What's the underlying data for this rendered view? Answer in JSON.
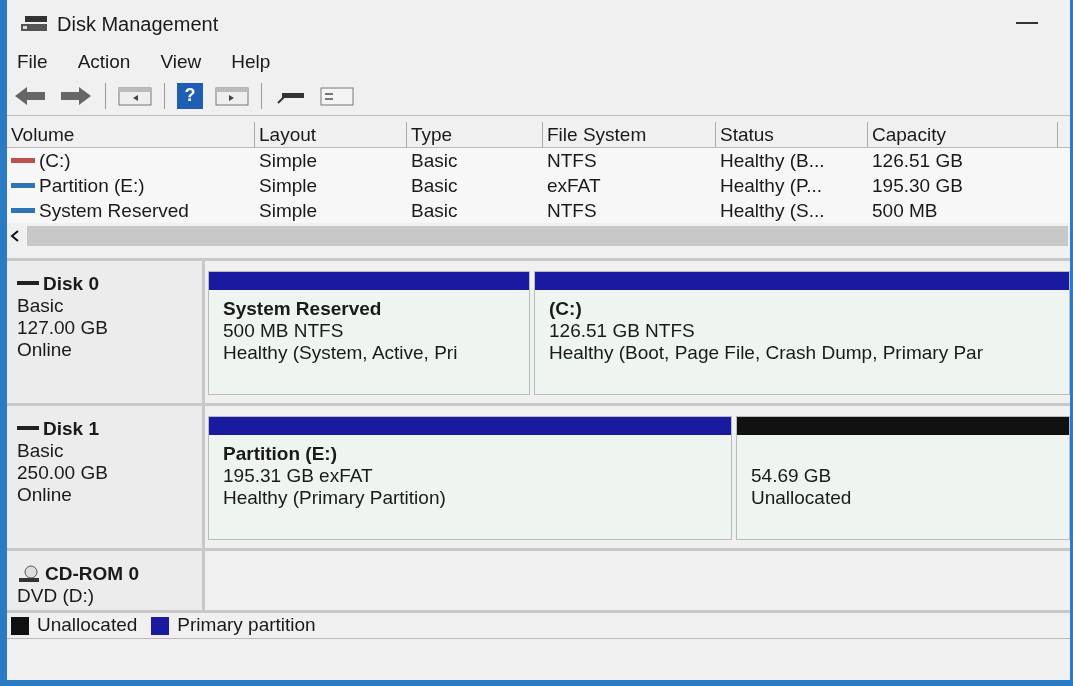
{
  "window": {
    "title": "Disk Management"
  },
  "menu": [
    "File",
    "Action",
    "View",
    "Help"
  ],
  "toolbar": {
    "help_glyph": "?"
  },
  "table": {
    "columns": [
      "Volume",
      "Layout",
      "Type",
      "File System",
      "Status",
      "Capacity"
    ],
    "rows": [
      {
        "cells": [
          "(C:)",
          "Simple",
          "Basic",
          "NTFS",
          "Healthy (B...",
          "126.51 GB"
        ]
      },
      {
        "cells": [
          "Partition (E:)",
          "Simple",
          "Basic",
          "exFAT",
          "Healthy (P...",
          "195.30 GB"
        ]
      },
      {
        "cells": [
          "System Reserved",
          "Simple",
          "Basic",
          "NTFS",
          "Healthy (S...",
          "500 MB"
        ]
      }
    ]
  },
  "disks": [
    {
      "kind": "disk",
      "name": "Disk 0",
      "lines": [
        "Basic",
        "127.00 GB",
        "Online"
      ],
      "partitions": [
        {
          "kind": "primary",
          "name": "System Reserved",
          "size": "500 MB NTFS",
          "status": "Healthy (System, Active, Pri"
        },
        {
          "kind": "primary",
          "name": "(C:)",
          "size": "126.51 GB NTFS",
          "status": "Healthy (Boot, Page File, Crash Dump, Primary Par"
        }
      ]
    },
    {
      "kind": "disk",
      "name": "Disk 1",
      "lines": [
        "Basic",
        "250.00 GB",
        "Online"
      ],
      "partitions": [
        {
          "kind": "primary",
          "name": "Partition  (E:)",
          "size": "195.31 GB exFAT",
          "status": "Healthy (Primary Partition)"
        },
        {
          "kind": "unallocated",
          "size": "54.69 GB",
          "status": "Unallocated"
        }
      ]
    },
    {
      "kind": "cdrom",
      "name": "CD-ROM 0",
      "lines": [
        "DVD (D:)"
      ]
    }
  ],
  "legend": [
    {
      "kind": "unallocated",
      "label": "Unallocated"
    },
    {
      "kind": "primary",
      "label": "Primary partition"
    }
  ]
}
